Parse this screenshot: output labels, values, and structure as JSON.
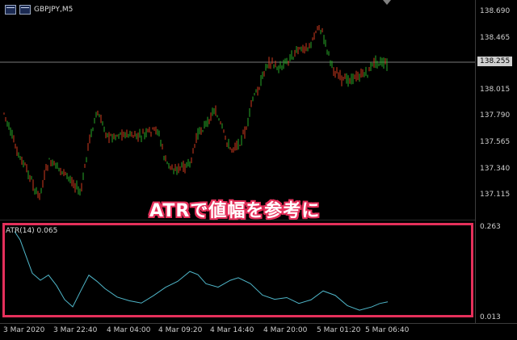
{
  "window": {
    "title": "GBPJPY,M5"
  },
  "main_chart": {
    "current_price": "138.255",
    "price_ticks": [
      "138.690",
      "138.465",
      "138.255",
      "138.015",
      "137.790",
      "137.565",
      "137.340",
      "137.115"
    ],
    "bull_color": "#28a828",
    "bear_color": "#d03a1e"
  },
  "indicator": {
    "label": "ATR(14) 0.065",
    "ticks": [
      "0.263",
      "0.013"
    ],
    "line_color": "#4fb6c9"
  },
  "time_ticks": [
    "3 Mar 2020",
    "3 Mar 22:40",
    "4 Mar 04:00",
    "4 Mar 09:20",
    "4 Mar 14:40",
    "4 Mar 20:00",
    "5 Mar 01:20",
    "5 Mar 06:40"
  ],
  "annotation": {
    "text": "ATRで値幅を参考に",
    "frame_color": "#e5305b"
  }
}
